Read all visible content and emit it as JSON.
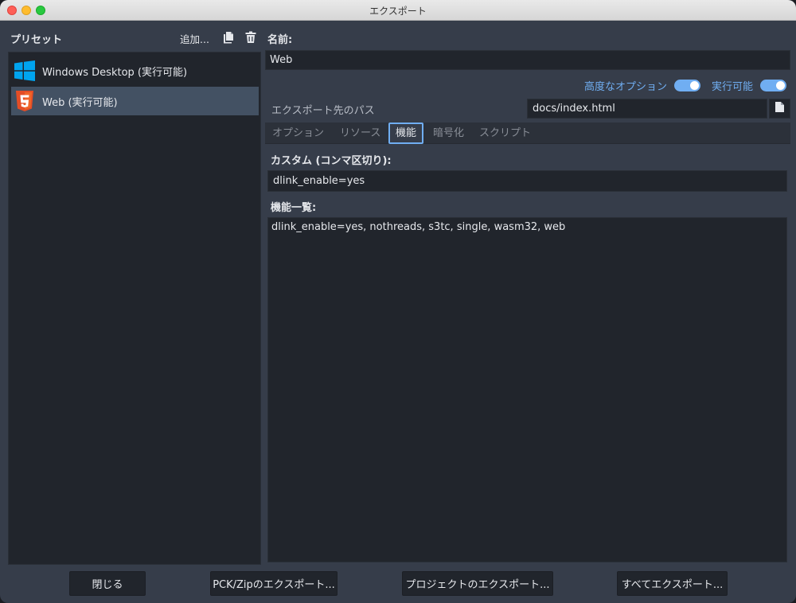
{
  "window": {
    "title": "エクスポート"
  },
  "presets": {
    "label": "プリセット",
    "add_label": "追加...",
    "items": [
      {
        "label": "Windows Desktop (実行可能)",
        "icon": "windows-logo-icon",
        "selected": false
      },
      {
        "label": "Web (実行可能)",
        "icon": "html5-logo-icon",
        "selected": true
      }
    ]
  },
  "details": {
    "name_label": "名前:",
    "name_value": "Web",
    "advanced_options_label": "高度なオプション",
    "advanced_options_on": true,
    "runnable_label": "実行可能",
    "runnable_on": true,
    "export_path_label": "エクスポート先のパス",
    "export_path_value": "docs/index.html",
    "tabs": [
      {
        "label": "オプション",
        "active": false
      },
      {
        "label": "リソース",
        "active": false
      },
      {
        "label": "機能",
        "active": true
      },
      {
        "label": "暗号化",
        "active": false
      },
      {
        "label": "スクリプト",
        "active": false
      }
    ],
    "features": {
      "custom_label": "カスタム (コンマ区切り):",
      "custom_value": "dlink_enable=yes",
      "list_label": "機能一覧:",
      "list_value": "dlink_enable=yes, nothreads, s3tc, single, wasm32, web"
    }
  },
  "footer": {
    "close_label": "閉じる",
    "export_pck_label": "PCK/Zipのエクスポート...",
    "export_project_label": "プロジェクトのエクスポート...",
    "export_all_label": "すべてエクスポート..."
  },
  "colors": {
    "accent": "#70aef2",
    "panel_bg": "#363d4a",
    "field_bg": "#21252c",
    "selected_bg": "#435163",
    "windows_blue": "#00a4ef",
    "html5_orange": "#e44d26"
  }
}
